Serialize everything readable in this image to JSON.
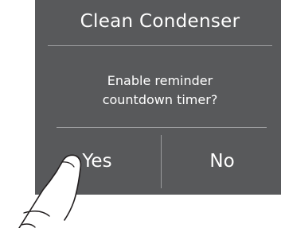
{
  "dialog": {
    "title": "Clean Condenser",
    "message_line1": "Enable reminder",
    "message_line2": "countdown timer?",
    "yes_label": "Yes",
    "no_label": "No"
  },
  "colors": {
    "dialog_background": "#58595b",
    "text": "#ffffff",
    "divider": "#9b9c9e",
    "hand_outline": "#231f20"
  },
  "icons": {
    "pointer": "pointing-hand-icon"
  }
}
